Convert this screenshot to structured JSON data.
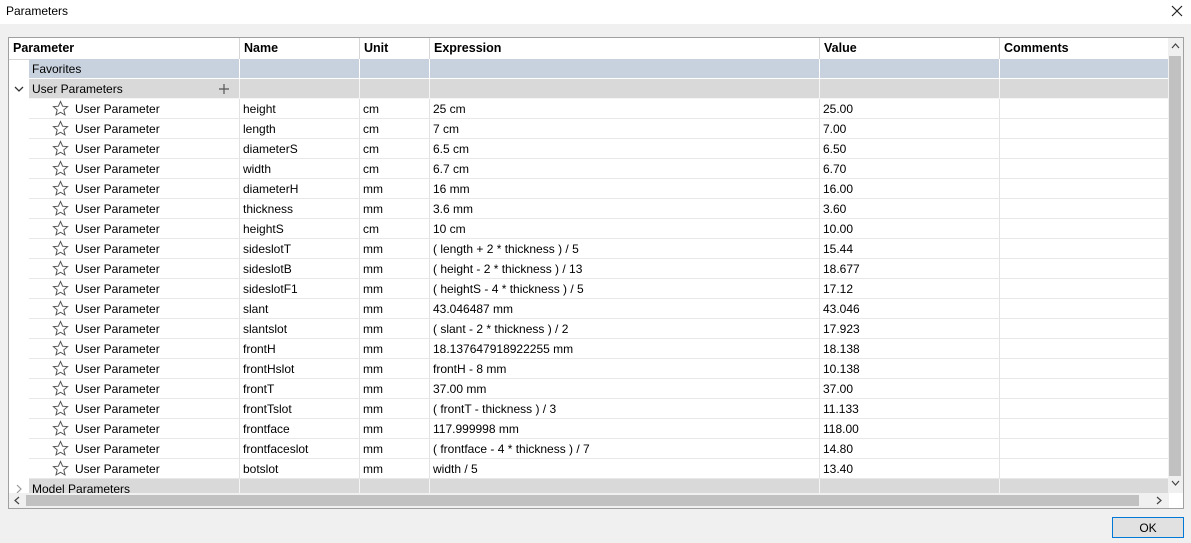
{
  "window": {
    "title": "Parameters"
  },
  "columns": {
    "parameter": "Parameter",
    "name": "Name",
    "unit": "Unit",
    "expression": "Expression",
    "value": "Value",
    "comments": "Comments"
  },
  "groups": {
    "favorites": "Favorites",
    "user_parameters": "User Parameters",
    "model_parameters": "Model Parameters"
  },
  "rows": [
    {
      "type": "User Parameter",
      "name": "height",
      "unit": "cm",
      "expression": "25 cm",
      "value": "25.00"
    },
    {
      "type": "User Parameter",
      "name": "length",
      "unit": "cm",
      "expression": "7 cm",
      "value": "7.00"
    },
    {
      "type": "User Parameter",
      "name": "diameterS",
      "unit": "cm",
      "expression": "6.5 cm",
      "value": "6.50"
    },
    {
      "type": "User Parameter",
      "name": "width",
      "unit": "cm",
      "expression": "6.7 cm",
      "value": "6.70"
    },
    {
      "type": "User Parameter",
      "name": "diameterH",
      "unit": "mm",
      "expression": "16 mm",
      "value": "16.00"
    },
    {
      "type": "User Parameter",
      "name": "thickness",
      "unit": "mm",
      "expression": "3.6 mm",
      "value": "3.60"
    },
    {
      "type": "User Parameter",
      "name": "heightS",
      "unit": "cm",
      "expression": "10 cm",
      "value": "10.00"
    },
    {
      "type": "User Parameter",
      "name": "sideslotT",
      "unit": "mm",
      "expression": "( length + 2 * thickness ) / 5",
      "value": "15.44"
    },
    {
      "type": "User Parameter",
      "name": "sideslotB",
      "unit": "mm",
      "expression": "( height - 2 * thickness ) / 13",
      "value": "18.677"
    },
    {
      "type": "User Parameter",
      "name": "sideslotF1",
      "unit": "mm",
      "expression": "( heightS - 4 * thickness ) / 5",
      "value": "17.12"
    },
    {
      "type": "User Parameter",
      "name": "slant",
      "unit": "mm",
      "expression": "43.046487 mm",
      "value": "43.046"
    },
    {
      "type": "User Parameter",
      "name": "slantslot",
      "unit": "mm",
      "expression": "( slant - 2 * thickness ) / 2",
      "value": "17.923"
    },
    {
      "type": "User Parameter",
      "name": "frontH",
      "unit": "mm",
      "expression": "18.137647918922255 mm",
      "value": "18.138"
    },
    {
      "type": "User Parameter",
      "name": "frontHslot",
      "unit": "mm",
      "expression": "frontH - 8 mm",
      "value": "10.138"
    },
    {
      "type": "User Parameter",
      "name": "frontT",
      "unit": "mm",
      "expression": "37.00 mm",
      "value": "37.00"
    },
    {
      "type": "User Parameter",
      "name": "frontTslot",
      "unit": "mm",
      "expression": "( frontT - thickness ) / 3",
      "value": "11.133"
    },
    {
      "type": "User Parameter",
      "name": "frontface",
      "unit": "mm",
      "expression": "117.999998 mm",
      "value": "118.00"
    },
    {
      "type": "User Parameter",
      "name": "frontfaceslot",
      "unit": "mm",
      "expression": "( frontface - 4 * thickness ) / 7",
      "value": "14.80"
    },
    {
      "type": "User Parameter",
      "name": "botslot",
      "unit": "mm",
      "expression": "width / 5",
      "value": "13.40"
    }
  ],
  "buttons": {
    "ok": "OK"
  },
  "colors": {
    "favorites_bg": "#c8d2de",
    "group_bg": "#d9d9d9",
    "ok_border": "#0078d7"
  }
}
